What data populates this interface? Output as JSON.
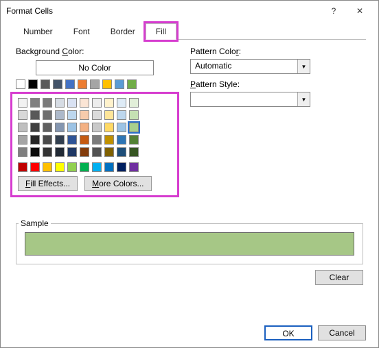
{
  "title": "Format Cells",
  "tabs": [
    "Number",
    "Font",
    "Border",
    "Fill"
  ],
  "activeTab": "Fill",
  "bgLabelPre": "Background ",
  "bgLabelU": "C",
  "bgLabelPost": "olor:",
  "noColor": "No Color",
  "theme1": [
    "#ffffff",
    "#000000",
    "#595959",
    "#44546a",
    "#4472c4",
    "#ed7d31",
    "#a5a5a5",
    "#ffc000",
    "#5b9bd5",
    "#70ad47"
  ],
  "theme2": [
    [
      "#f2f2f2",
      "#808080",
      "#7b7b7b",
      "#d6dce4",
      "#d9e2f3",
      "#fbe5d5",
      "#ededed",
      "#fff2cc",
      "#deebf6",
      "#e2efd9"
    ],
    [
      "#d8d8d8",
      "#595959",
      "#6e6e6e",
      "#adb9ca",
      "#bdd7ee",
      "#f7cbac",
      "#dbdbdb",
      "#fee599",
      "#bdd7ee",
      "#c5e0b3"
    ],
    [
      "#bfbfbf",
      "#3f3f3f",
      "#606060",
      "#8496b0",
      "#9cc3e5",
      "#f4b183",
      "#c9c9c9",
      "#ffd965",
      "#9cc3e5",
      "#a8d08d"
    ],
    [
      "#a5a5a5",
      "#262626",
      "#4a4a4a",
      "#323f4f",
      "#2f5496",
      "#c55a11",
      "#7b7b7b",
      "#bf9000",
      "#2e75b5",
      "#538135"
    ],
    [
      "#7f7f7f",
      "#0c0c0c",
      "#333333",
      "#222a35",
      "#1f3864",
      "#833c0b",
      "#525252",
      "#7f6000",
      "#1e4e79",
      "#375623"
    ]
  ],
  "standard": [
    "#c00000",
    "#ff0000",
    "#ffc000",
    "#ffff00",
    "#92d050",
    "#00b050",
    "#00b0f0",
    "#0070c0",
    "#002060",
    "#7030a0"
  ],
  "selectedSwatch": "2-9",
  "fillEffects": "Fill Effects...",
  "moreColors": "More Colors...",
  "patternColorLabel": "Pattern Color:",
  "patternColor": "Automatic",
  "patternStyleLabel": "Pattern Style:",
  "sampleLabel": "Sample",
  "sampleColor": "#a6c786",
  "clear": "Clear",
  "ok": "OK",
  "cancel": "Cancel"
}
